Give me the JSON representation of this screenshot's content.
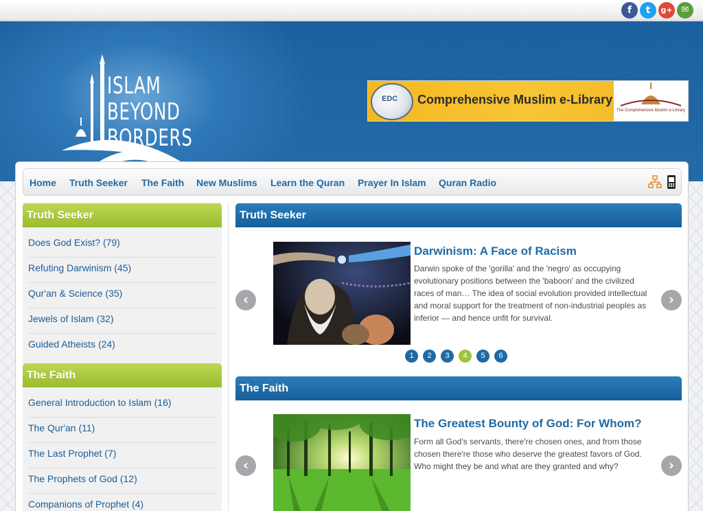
{
  "social": [
    {
      "name": "facebook",
      "glyph": "f",
      "color": "#3b5998"
    },
    {
      "name": "twitter",
      "glyph": "t",
      "color": "#1da1f2"
    },
    {
      "name": "google-plus",
      "glyph": "g+",
      "color": "#dd4b39"
    },
    {
      "name": "email",
      "glyph": "✉",
      "color": "#5a9e3a"
    }
  ],
  "logo": {
    "line1": "ISLAM",
    "line2": "BEYOND",
    "line3": "BORDERS"
  },
  "banner": {
    "text": "Comprehensive Muslim e-Library",
    "badge": "EDC",
    "right_caption": "The Comprehensive Muslim e-Library"
  },
  "nav": {
    "items": [
      "Home",
      "Truth Seeker",
      "The Faith",
      "New Muslims",
      "Learn the Quran",
      "Prayer In Islam",
      "Quran Radio"
    ],
    "sitemap_icon": "sitemap-icon",
    "mobile_icon": "mobile-phone-icon"
  },
  "sidebar": {
    "section1": {
      "title": "Truth Seeker",
      "links": [
        "Does God Exist? (79)",
        "Refuting Darwinism (45)",
        "Qur'an & Science (35)",
        "Jewels of Islam (32)",
        "Guided Atheists (24)"
      ]
    },
    "section2": {
      "title": "The Faith",
      "links": [
        "General Introduction to Islam (16)",
        "The Qur'an (11)",
        "The Last Prophet (7)",
        "The Prophets of God (12)",
        "Companions of Prophet (4)"
      ]
    }
  },
  "main": {
    "section1": {
      "title": "Truth Seeker",
      "article_title": "Darwinism: A Face of Racism",
      "article_body": "Darwin spoke of the 'gorilla' and the 'negro' as occupying evolutionary positions between the 'baboon' and the civilized races of man… The idea of social evolution provided intellectual and moral support for the treatment of non-industrial peoples as inferior — and hence unfit for survival.",
      "pages": [
        "1",
        "2",
        "3",
        "4",
        "5",
        "6"
      ],
      "active_page": "4"
    },
    "section2": {
      "title": "The Faith",
      "article_title": "The Greatest Bounty of God: For Whom?",
      "article_body": "Form all God's servants, there're chosen ones, and from those chosen there're those who deserve the greatest favors of God. Who might they be and what are they granted and why?"
    }
  },
  "arrows": {
    "prev": "‹",
    "next": "›"
  }
}
